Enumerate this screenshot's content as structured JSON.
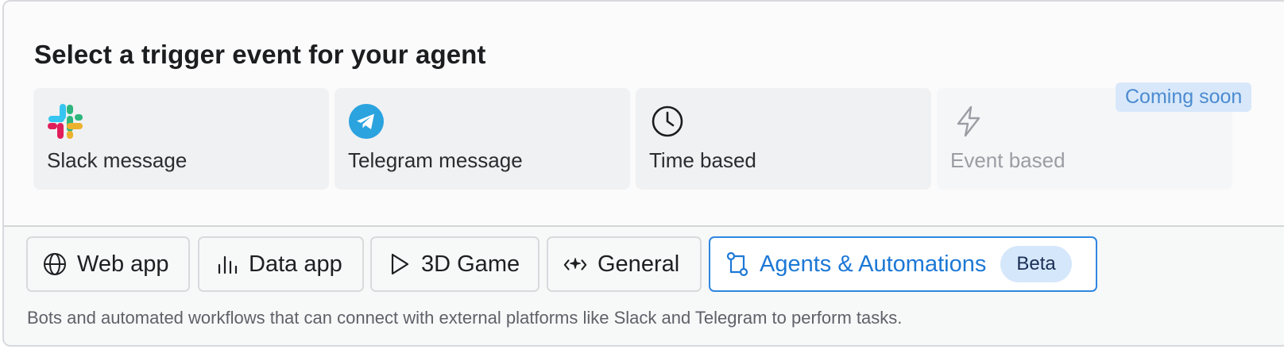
{
  "trigger": {
    "title": "Select a trigger event for your agent",
    "options": [
      {
        "label": "Slack message",
        "icon": "slack-icon"
      },
      {
        "label": "Telegram message",
        "icon": "telegram-icon"
      },
      {
        "label": "Time based",
        "icon": "clock-icon"
      },
      {
        "label": "Event based",
        "icon": "lightning-icon",
        "badge": "Coming soon"
      }
    ]
  },
  "templates": {
    "tabs": [
      {
        "label": "Web app",
        "icon": "globe-icon"
      },
      {
        "label": "Data app",
        "icon": "bar-chart-icon"
      },
      {
        "label": "3D Game",
        "icon": "play-icon"
      },
      {
        "label": "General",
        "icon": "code-sparkle-icon"
      },
      {
        "label": "Agents & Automations",
        "icon": "workflow-icon",
        "badge": "Beta",
        "selected": true
      }
    ],
    "description": "Bots and automated workflows that can connect with external platforms like Slack and Telegram to perform tasks."
  },
  "colors": {
    "accent": "#1c78d6",
    "badge_bg": "#d5e7fa"
  }
}
